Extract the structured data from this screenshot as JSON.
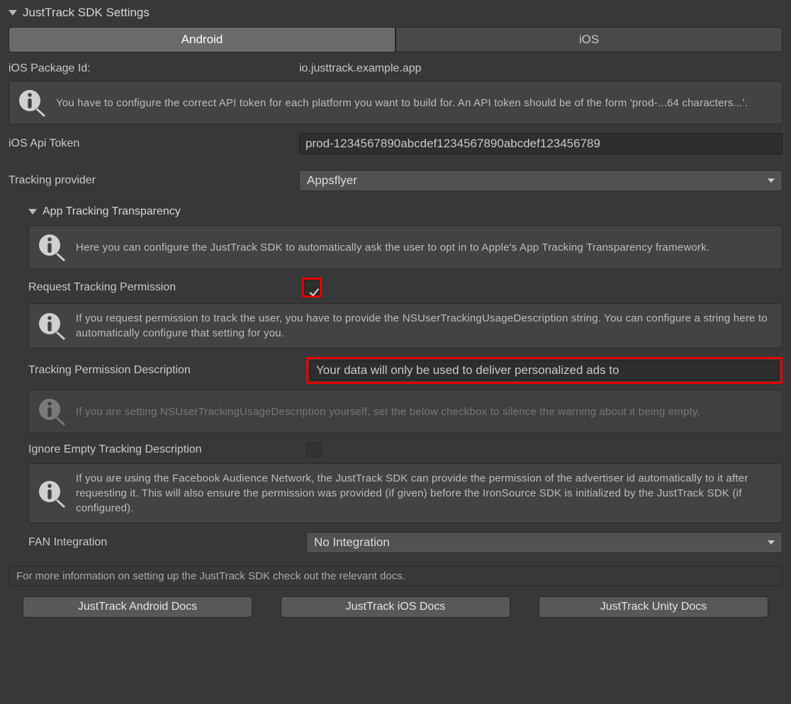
{
  "header": {
    "title": "JustTrack SDK Settings"
  },
  "tabs": {
    "android": "Android",
    "ios": "iOS",
    "active": "android"
  },
  "packageId": {
    "label": "iOS Package Id:",
    "value": "io.justtrack.example.app"
  },
  "info_api_token": "You have to configure the correct API token for each platform you want to build for. An API token should be of the form 'prod-...64 characters...'.",
  "apiToken": {
    "label": "iOS Api Token",
    "value": "prod-1234567890abcdef1234567890abcdef123456789"
  },
  "trackingProvider": {
    "label": "Tracking provider",
    "value": "Appsflyer"
  },
  "att": {
    "title": "App Tracking Transparency",
    "info_intro": "Here you can configure the JustTrack SDK to automatically ask the user to opt in to Apple's App Tracking Transparency framework.",
    "requestPermission": {
      "label": "Request Tracking Permission",
      "checked": true
    },
    "info_permission": "If you request permission to track the user, you have to provide the NSUserTrackingUsageDescription string. You can configure a string here to automatically configure that setting for you.",
    "description": {
      "label": "Tracking Permission Description",
      "value": "Your data will only be used to deliver personalized ads to"
    },
    "info_ignore": "If you are setting NSUserTrackingUsageDescription yourself, set the below checkbox to silence the warning about it being empty.",
    "ignoreEmpty": {
      "label": "Ignore Empty Tracking Description",
      "checked": false
    },
    "info_fan": "If you are using the Facebook Audience Network, the JustTrack SDK can provide the permission of the advertiser id automatically to it after requesting it. This will also ensure the permission was provided (if given) before the IronSource SDK is initialized by the JustTrack SDK (if configured).",
    "fan": {
      "label": "FAN Integration",
      "value": "No Integration"
    }
  },
  "footer_note": "For more information on setting up the JustTrack SDK check out the relevant docs.",
  "buttons": {
    "android_docs": "JustTrack Android Docs",
    "ios_docs": "JustTrack iOS Docs",
    "unity_docs": "JustTrack Unity Docs"
  }
}
